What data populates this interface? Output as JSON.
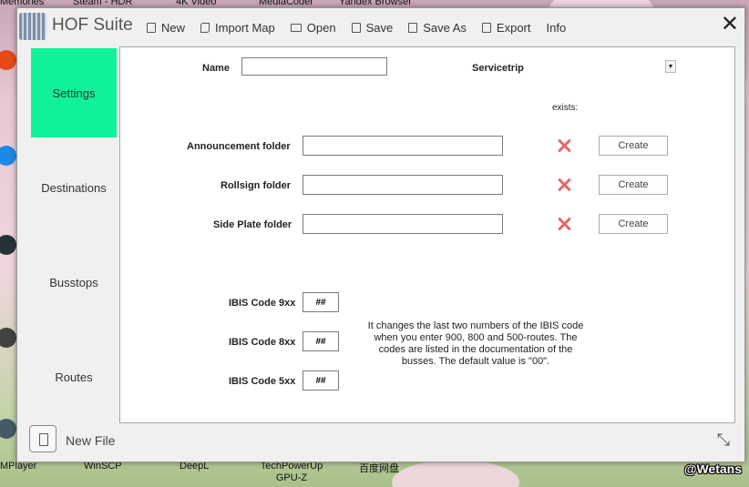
{
  "app": {
    "title": "HOF Suite"
  },
  "menu": {
    "new": "New",
    "import_map": "Import Map",
    "open": "Open",
    "save": "Save",
    "save_as": "Save As",
    "export": "Export",
    "info": "Info"
  },
  "sidebar": {
    "items": [
      {
        "label": "Settings",
        "active": true
      },
      {
        "label": "Destinations",
        "active": false
      },
      {
        "label": "Busstops",
        "active": false
      },
      {
        "label": "Routes",
        "active": false
      }
    ]
  },
  "settings": {
    "name_label": "Name",
    "name_value": "",
    "servicetrip_label": "Servicetrip",
    "exists_label": "exists:",
    "folders": [
      {
        "label": "Announcement folder",
        "value": "",
        "exists": false,
        "button": "Create"
      },
      {
        "label": "Rollsign folder",
        "value": "",
        "exists": false,
        "button": "Create"
      },
      {
        "label": "Side Plate folder",
        "value": "",
        "exists": false,
        "button": "Create"
      }
    ],
    "ibis": [
      {
        "label": "IBIS Code 9xx",
        "value": "##"
      },
      {
        "label": "IBIS Code 8xx",
        "value": "##"
      },
      {
        "label": "IBIS Code 5xx",
        "value": "##"
      }
    ],
    "info_text": "It changes the last two numbers of the IBIS code when you enter 900, 800 and 500-routes. The codes are listed in the documentation of the busses. The default value is \"00\"."
  },
  "footer": {
    "file_label": "New File"
  },
  "desktop": {
    "labels_top": [
      "Memories",
      "Steam - HDR",
      "4K Video",
      "MediaCoder",
      "Yandex Browser"
    ],
    "labels_bottom": [
      "MPlayer",
      "WinSCP",
      "DeepL",
      "TechPowerUp GPU-Z",
      "百度网盘"
    ],
    "watermark": "@Wetans"
  },
  "colors": {
    "accent": "#10f29a",
    "error": "#e06a6a"
  }
}
